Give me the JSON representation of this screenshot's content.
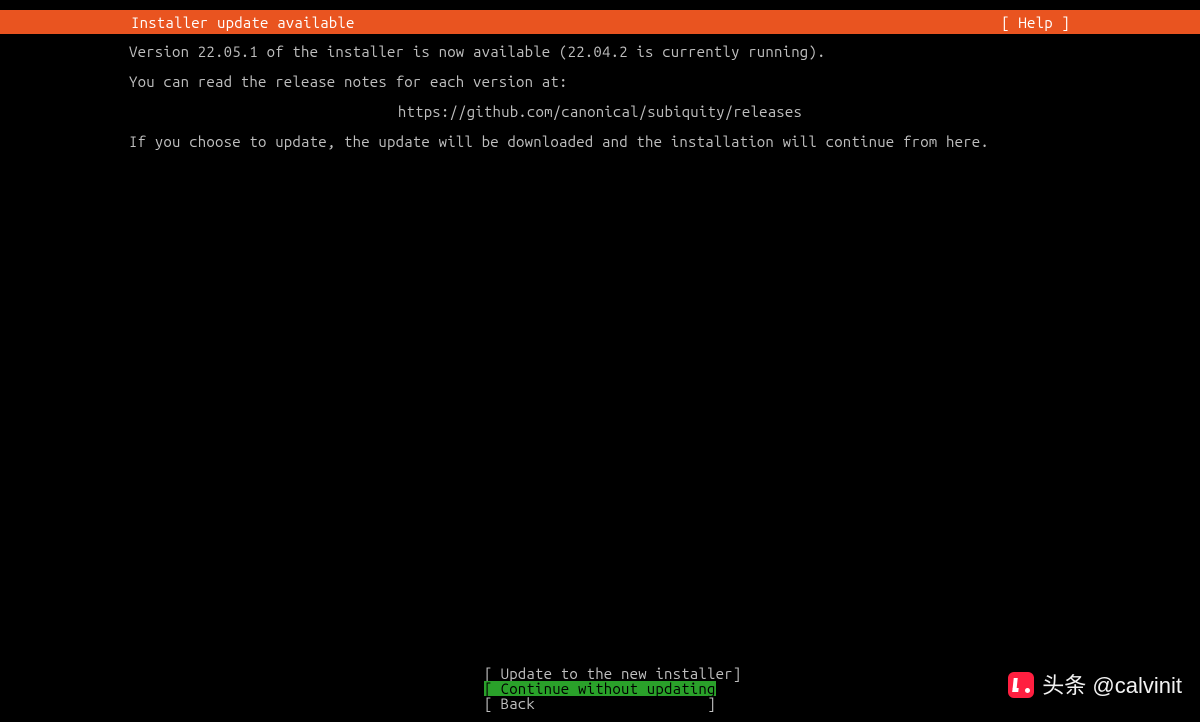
{
  "header": {
    "title": "Installer update available",
    "help": "[ Help ]"
  },
  "body": {
    "line1": "Version 22.05.1 of the installer is now available (22.04.2 is currently running).",
    "line2": "You can read the release notes for each version at:",
    "release_url": "https://github.com/canonical/subiquity/releases",
    "line3": "If you choose to update, the update will be downloaded and the installation will continue from here."
  },
  "buttons": {
    "update": "Update to the new installer",
    "continue": "Continue without updating",
    "back": "Back"
  },
  "watermark": {
    "text": "头条 @calvinit"
  }
}
